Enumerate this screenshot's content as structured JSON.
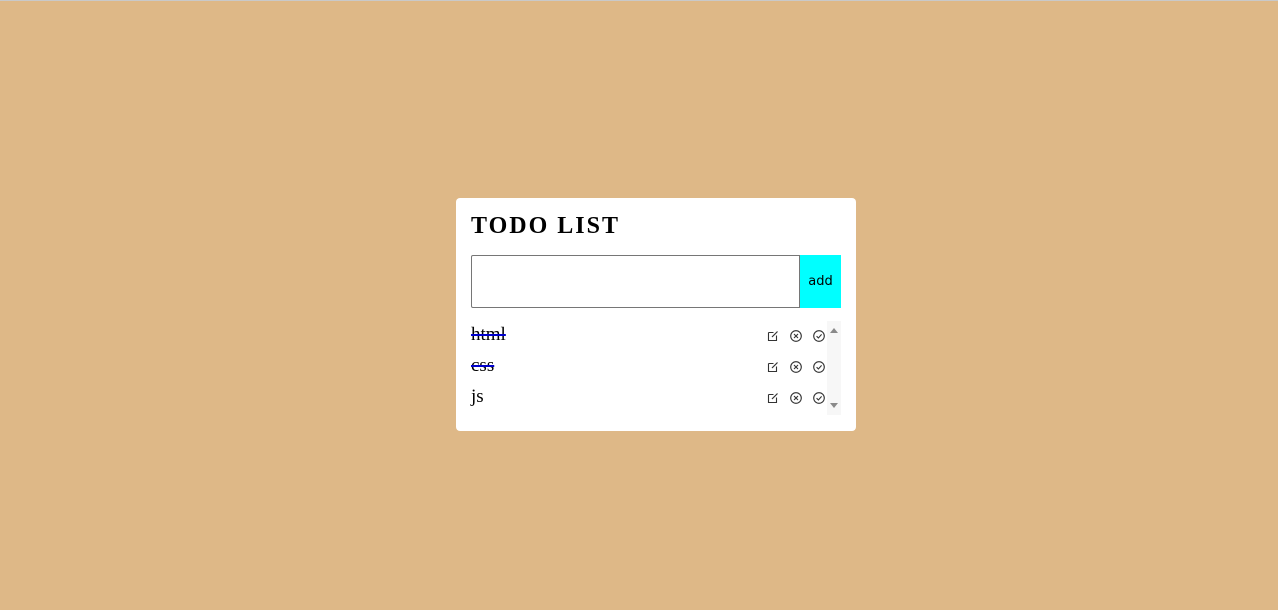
{
  "app": {
    "title": "TODO LIST"
  },
  "input": {
    "value": "",
    "placeholder": ""
  },
  "add_button": {
    "label": "add"
  },
  "todos": [
    {
      "text": "html",
      "completed": true
    },
    {
      "text": "css",
      "completed": true
    },
    {
      "text": "js",
      "completed": false
    }
  ],
  "icons": {
    "edit": "edit-icon",
    "delete": "delete-icon",
    "complete": "complete-icon"
  },
  "colors": {
    "page_background": "#deb887",
    "card_background": "#ffffff",
    "add_button_background": "#00ffff",
    "strikethrough": "#0000cd"
  }
}
